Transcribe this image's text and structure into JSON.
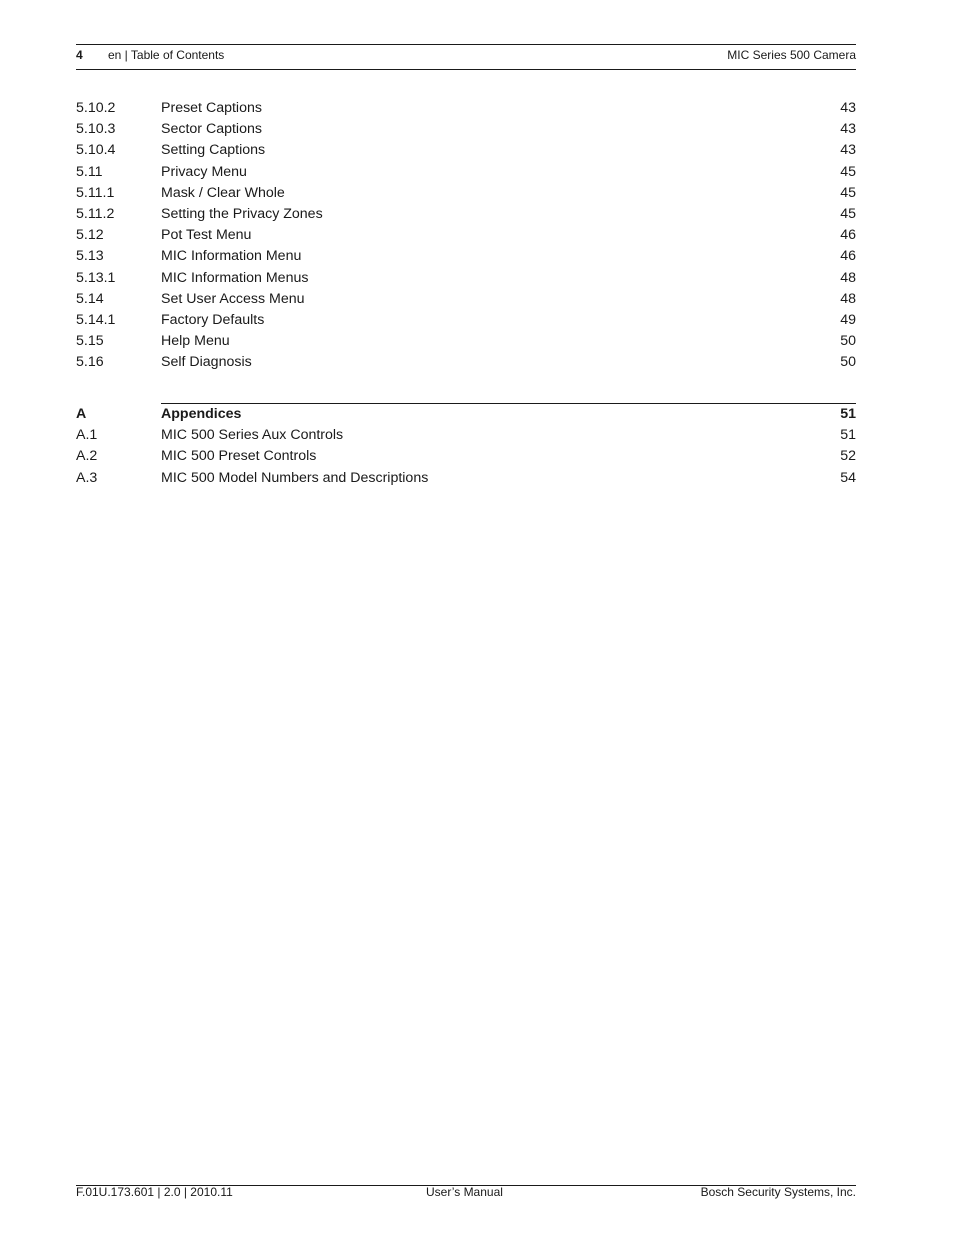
{
  "header": {
    "page_number": "4",
    "section": "en | Table of Contents",
    "document_title": "MIC Series 500 Camera"
  },
  "toc": [
    {
      "num": "5.10.2",
      "label": "Preset Captions",
      "page": "43"
    },
    {
      "num": "5.10.3",
      "label": "Sector Captions",
      "page": "43"
    },
    {
      "num": "5.10.4",
      "label": "Setting Captions",
      "page": "43"
    },
    {
      "num": "5.11",
      "label": "Privacy Menu",
      "page": "45"
    },
    {
      "num": "5.11.1",
      "label": "Mask / Clear Whole",
      "page": "45"
    },
    {
      "num": "5.11.2",
      "label": "Setting the Privacy Zones",
      "page": "45"
    },
    {
      "num": "5.12",
      "label": "Pot Test Menu",
      "page": "46"
    },
    {
      "num": "5.13",
      "label": "MIC Information Menu",
      "page": "46"
    },
    {
      "num": "5.13.1",
      "label": "MIC Information Menus",
      "page": "48"
    },
    {
      "num": "5.14",
      "label": "Set User Access Menu",
      "page": "48"
    },
    {
      "num": "5.14.1",
      "label": "Factory Defaults",
      "page": "49"
    },
    {
      "num": "5.15",
      "label": "Help Menu",
      "page": "50"
    },
    {
      "num": "5.16",
      "label": "Self Diagnosis",
      "page": "50"
    }
  ],
  "appendix": {
    "heading": {
      "num": "A",
      "label": "Appendices",
      "page": "51"
    },
    "items": [
      {
        "num": "A.1",
        "label": "MIC 500 Series Aux Controls",
        "page": "51"
      },
      {
        "num": "A.2",
        "label": "MIC 500 Preset Controls",
        "page": "52"
      },
      {
        "num": "A.3",
        "label": "MIC 500 Model Numbers and Descriptions",
        "page": "54"
      }
    ]
  },
  "footer": {
    "doc_id": "F.01U.173.601 | 2.0 | 2010.11",
    "doc_type": "User’s Manual",
    "company": "Bosch Security Systems, Inc."
  }
}
